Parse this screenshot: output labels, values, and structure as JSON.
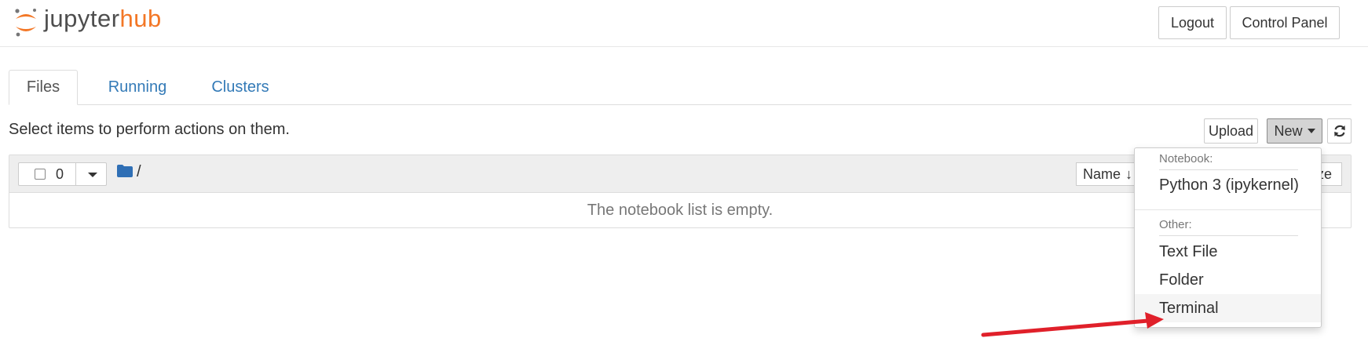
{
  "header": {
    "logo_jupyter": "jupyter",
    "logo_hub": "hub",
    "logout_label": "Logout",
    "control_panel_label": "Control Panel"
  },
  "tabs": [
    {
      "label": "Files",
      "active": true
    },
    {
      "label": "Running",
      "active": false
    },
    {
      "label": "Clusters",
      "active": false
    }
  ],
  "toolbar": {
    "hint": "Select items to perform actions on them.",
    "upload_label": "Upload",
    "new_label": "New",
    "refresh_icon": "refresh-icon"
  },
  "file_list": {
    "selected_count": "0",
    "path": "/",
    "sort_name_label": "Name",
    "sort_size_label": "ze",
    "empty_message": "The notebook list is empty."
  },
  "new_menu": {
    "notebook_header": "Notebook:",
    "notebook_items": [
      "Python 3 (ipykernel)"
    ],
    "other_header": "Other:",
    "other_items": [
      "Text File",
      "Folder",
      "Terminal"
    ],
    "highlighted_item": "Terminal"
  },
  "colors": {
    "brand_orange": "#f37726",
    "link_blue": "#337ab7",
    "annotation_red": "#e0202a"
  }
}
